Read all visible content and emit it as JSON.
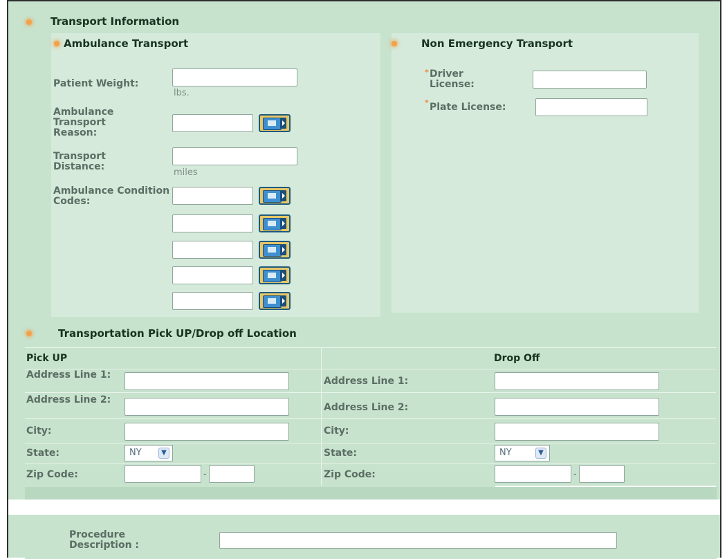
{
  "transport_info": {
    "title": "Transport Information",
    "ambulance": {
      "title": "Ambulance Transport",
      "patient_weight_label": "Patient Weight:",
      "patient_weight_value": "",
      "weight_unit": "lbs.",
      "transport_reason_label": "Ambulance Transport Reason:",
      "transport_reason_value": "",
      "transport_distance_label": "Transport Distance:",
      "transport_distance_value": "",
      "distance_unit": "miles",
      "condition_codes_label": "Ambulance Condition Codes:",
      "condition_codes": [
        "",
        "",
        "",
        "",
        ""
      ]
    },
    "non_emergency": {
      "title": "Non Emergency Transport",
      "driver_license_label": "Driver License:",
      "driver_license_value": "",
      "plate_license_label": "Plate License:",
      "plate_license_value": "",
      "required_marker": "*"
    }
  },
  "location": {
    "title": "Transportation Pick UP/Drop off Location",
    "pickup": {
      "header": "Pick UP",
      "address1_label": "Address Line 1:",
      "address2_label": "Address Line 2:",
      "city_label": "City:",
      "state_label": "State:",
      "state_value": "NY",
      "zip_label": "Zip Code:",
      "zip_separator": "-"
    },
    "dropoff": {
      "header": "Drop Off",
      "address1_label": "Address Line 1:",
      "address2_label": "Address Line 2:",
      "city_label": "City:",
      "state_label": "State:",
      "state_value": "NY",
      "zip_label": "Zip Code:",
      "zip_separator": "-"
    }
  },
  "procedure": {
    "label": "Procedure Description :",
    "value": ""
  },
  "icons": {
    "section_bullet": "orange-bullet-icon",
    "lookup_button": "lookup-search-icon",
    "dropdown": "chevron-down-icon"
  },
  "colors": {
    "panel_background": "#c7e2cd",
    "inner_panel": "#d5eadb",
    "required_marker": "#f08a3a",
    "lookup_border": "#1e5a7e",
    "lookup_fill": "#e6c768"
  }
}
